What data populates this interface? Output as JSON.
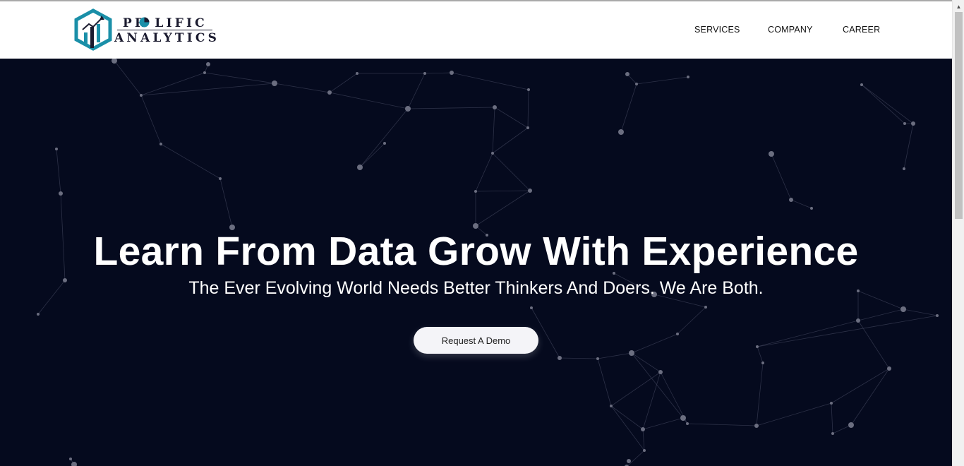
{
  "header": {
    "logo": {
      "line1": "PR LIFIC",
      "line2": "ANALYTICS"
    },
    "nav": [
      {
        "label": "SERVICES"
      },
      {
        "label": "COMPANY"
      },
      {
        "label": "CAREER"
      }
    ]
  },
  "hero": {
    "headline": "Learn From Data Grow With Experience",
    "subline": "The Ever Evolving World Needs Better Thinkers And Doers. We Are Both.",
    "cta_label": "Request A Demo"
  },
  "colors": {
    "hero_bg": "#050a1e",
    "logo_teal": "#1a8fa8",
    "logo_navy": "#1b1b2f",
    "node": "#6b6e80"
  },
  "icons": {
    "logo_mark": "hexagon-bar-chart-logo-icon",
    "scroll_up": "scroll-up-arrow-icon"
  }
}
